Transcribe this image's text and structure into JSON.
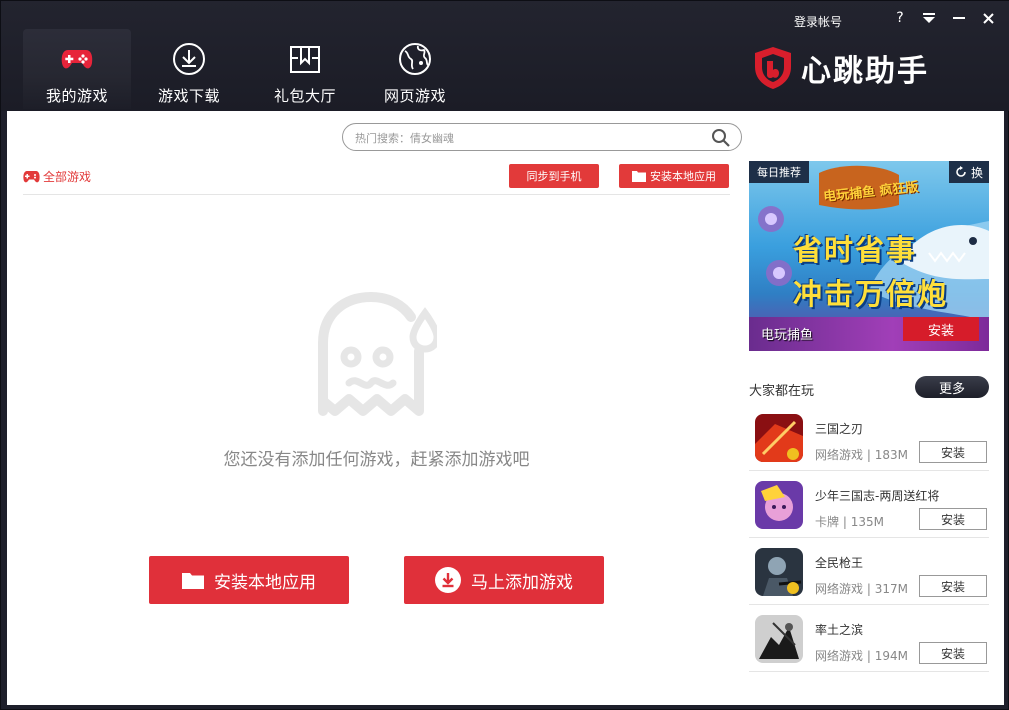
{
  "nav": {
    "tabs": [
      {
        "label": "我的游戏",
        "active": true,
        "icon": "gamepad-icon"
      },
      {
        "label": "游戏下载",
        "icon": "download-icon"
      },
      {
        "label": "礼包大厅",
        "icon": "gift-icon"
      },
      {
        "label": "网页游戏",
        "icon": "globe-icon"
      }
    ]
  },
  "header": {
    "login_label": "登录帐号",
    "brand_name": "心跳助手",
    "window_controls": {
      "help": "?",
      "menu": "▼",
      "minimize": "—",
      "close": "✕"
    }
  },
  "search": {
    "placeholder": "热门搜索：倩女幽魂"
  },
  "left": {
    "all_games_label": "全部游戏",
    "sync_button": "同步到手机",
    "install_local_button": "安装本地应用",
    "empty_message": "您还没有添加任何游戏，赶紧添加游戏吧",
    "big_install_button": "安装本地应用",
    "big_add_button": "马上添加游戏"
  },
  "banner": {
    "tag": "每日推荐",
    "switch_label": "换",
    "logo_text": "电玩捕鱼 疯狂版",
    "slogan_line1": "省时省事",
    "slogan_line2": "冲击万倍炮",
    "game_name": "电玩捕鱼",
    "install_label": "安装"
  },
  "popular": {
    "title": "大家都在玩",
    "more_label": "更多",
    "games": [
      {
        "name": "三国之刃",
        "category": "网络游戏",
        "size": "183M",
        "install": "安装",
        "thumb_colors": [
          "#8a0f12",
          "#e23a1a"
        ]
      },
      {
        "name": "少年三国志-两周送红将",
        "category": "卡牌",
        "size": "135M",
        "install": "安装",
        "thumb_colors": [
          "#6a3aa8",
          "#e8a0d8"
        ]
      },
      {
        "name": "全民枪王",
        "category": "网络游戏",
        "size": "317M",
        "install": "安装",
        "thumb_colors": [
          "#2a3440",
          "#8fa4b4"
        ]
      },
      {
        "name": "率土之滨",
        "category": "网络游戏",
        "size": "194M",
        "install": "安装",
        "thumb_colors": [
          "#1a1a1a",
          "#9a9a9a"
        ]
      }
    ]
  },
  "colors": {
    "accent_red": "#e0303a",
    "header_bg": "#1e1f2b"
  }
}
